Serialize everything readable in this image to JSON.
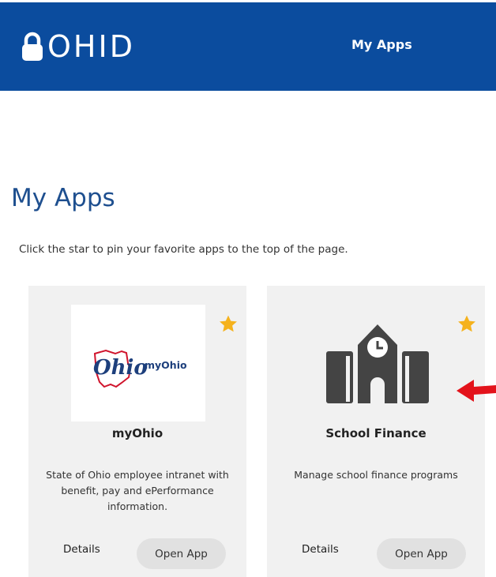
{
  "header": {
    "brand": "OHID",
    "nav_myapps": "My Apps",
    "color": "#0b4c9e"
  },
  "page": {
    "title": "My Apps",
    "intro": "Click the star to pin your favorite apps to the top of the page."
  },
  "apps": [
    {
      "name": "myOhio",
      "logo_script": "Ohio",
      "logo_text": "myOhio",
      "description": "State of Ohio employee intranet with benefit, pay and ePerformance information.",
      "details_label": "Details",
      "open_label": "Open App",
      "icon": "myohio-logo",
      "starred": true
    },
    {
      "name": "School Finance",
      "description": "Manage school finance programs",
      "details_label": "Details",
      "open_label": "Open App",
      "icon": "school-clock-icon",
      "starred": true
    }
  ],
  "colors": {
    "star": "#f5b21d",
    "arrow": "#e3131b",
    "title": "#1e4f8f"
  }
}
